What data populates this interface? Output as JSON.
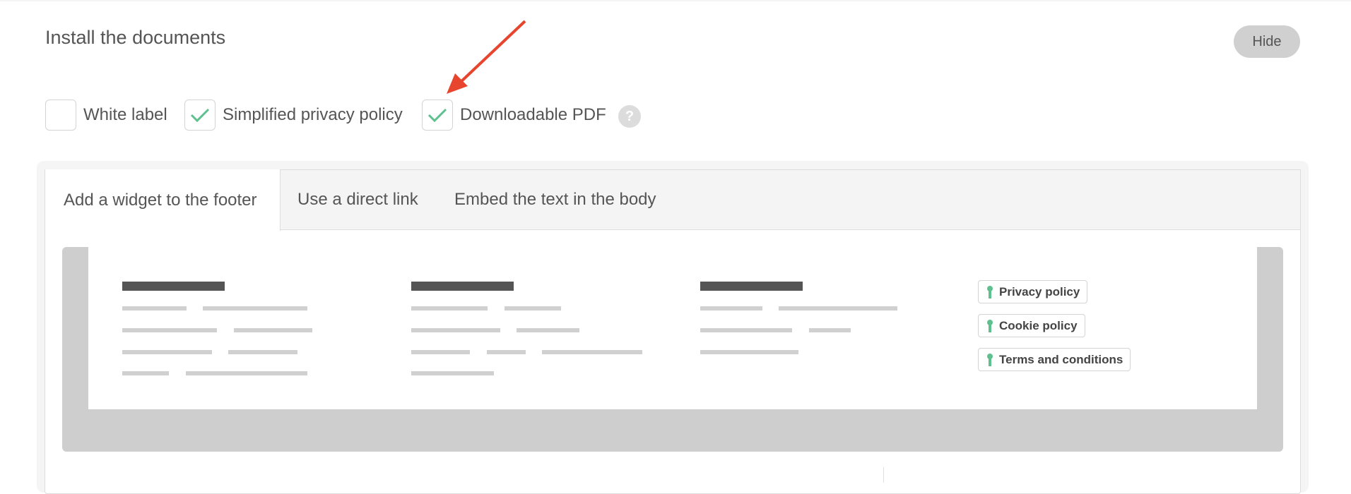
{
  "section": {
    "title": "Install the documents",
    "hide_label": "Hide"
  },
  "options": [
    {
      "label": "White label",
      "checked": false
    },
    {
      "label": "Simplified privacy policy",
      "checked": true
    },
    {
      "label": "Downloadable PDF",
      "checked": true
    }
  ],
  "help_glyph": "?",
  "tabs": [
    {
      "label": "Add a widget to the footer",
      "active": true
    },
    {
      "label": "Use a direct link",
      "active": false
    },
    {
      "label": "Embed the text in the body",
      "active": false
    }
  ],
  "footer_links": [
    {
      "label": "Privacy policy",
      "icon": "keyhole-icon"
    },
    {
      "label": "Cookie policy",
      "icon": "keyhole-icon"
    },
    {
      "label": "Terms and conditions",
      "icon": "keyhole-icon"
    }
  ],
  "colors": {
    "check": "#5ec08f",
    "arrow": "#e8452f",
    "hide_button_bg": "#d0d0d0",
    "preview_bg": "#cecece"
  }
}
